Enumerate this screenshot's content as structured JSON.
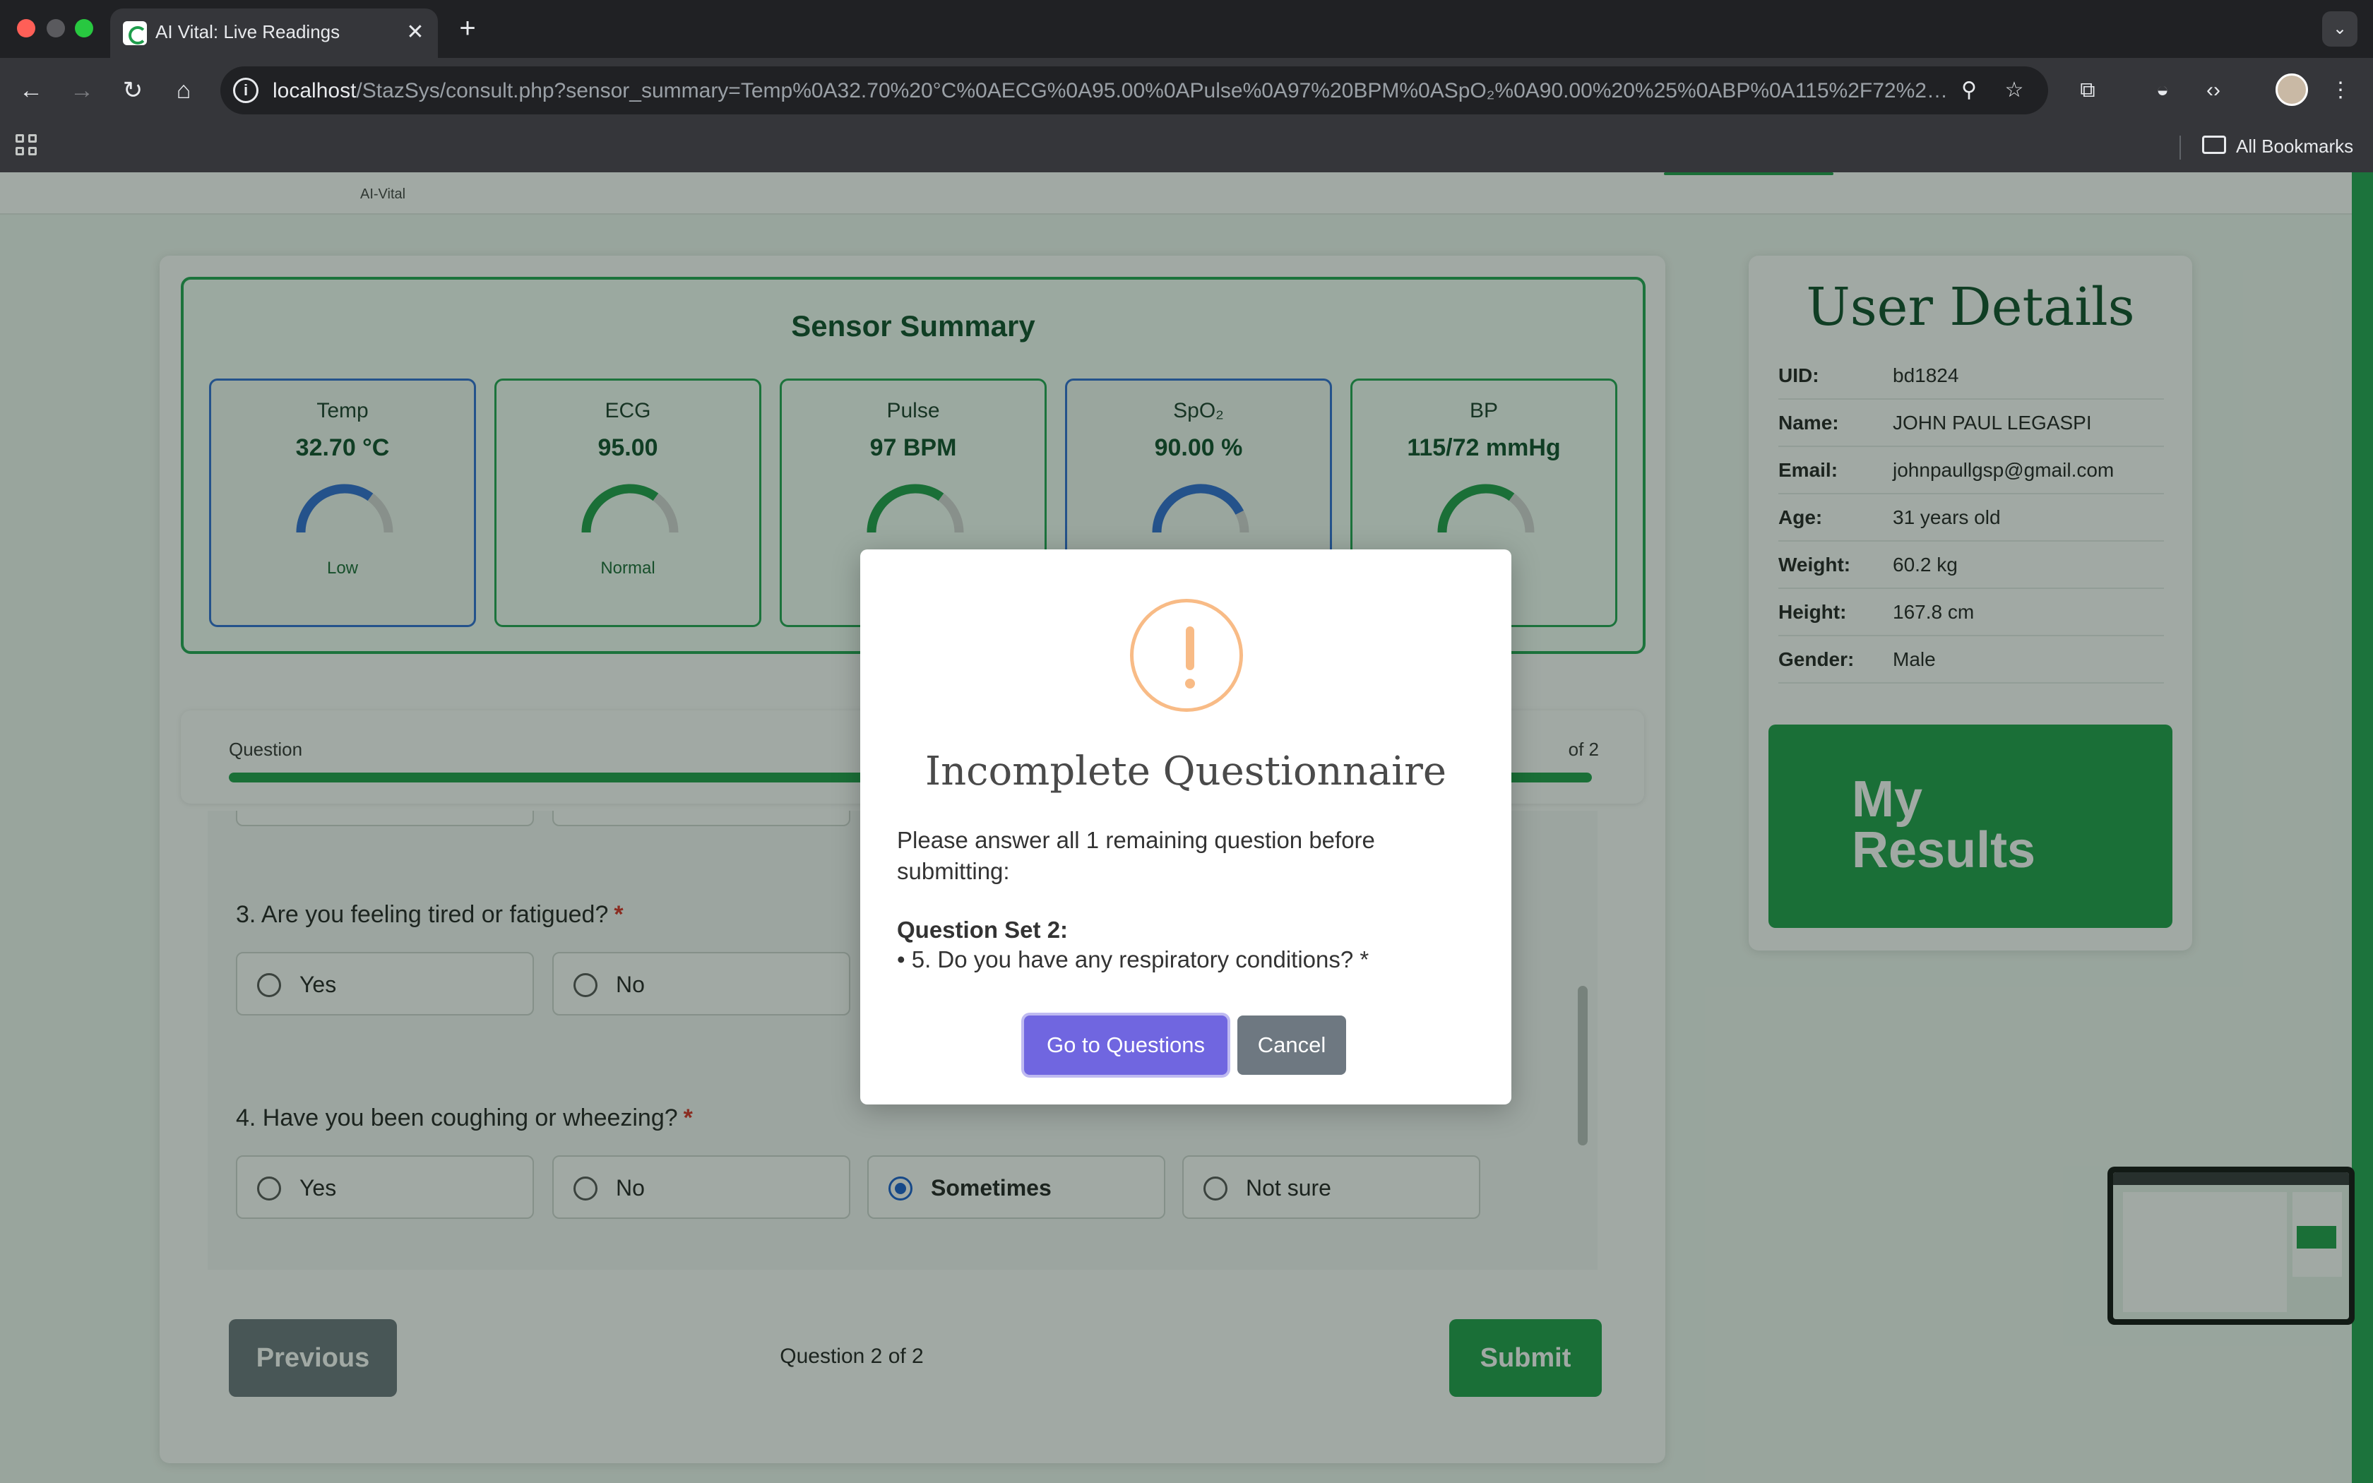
{
  "browser": {
    "tab_title": "AI Vital: Live Readings",
    "url_host": "localhost",
    "url_rest": "/StazSys/consult.php?sensor_summary=Temp%0A32.70%20°C%0AECG%0A95.00%0APulse%0A97%20BPM%0ASpO₂%0A90.00%20%25%0ABP%0A115%2F72%20...",
    "bookmarks_label": "All Bookmarks"
  },
  "header": {
    "logo_text": "AI-Vital"
  },
  "sensor_summary": {
    "title": "Sensor Summary",
    "cards": [
      {
        "name": "Temp",
        "value": "32.70 °C",
        "status": "Low",
        "level": 0.7,
        "color": "#2f6fd6",
        "state": "low"
      },
      {
        "name": "ECG",
        "value": "95.00",
        "status": "Normal",
        "level": 0.7,
        "color": "#1e9e4a",
        "state": "normal"
      },
      {
        "name": "Pulse",
        "value": "97 BPM",
        "status": "",
        "level": 0.7,
        "color": "#1e9e4a",
        "state": "normal"
      },
      {
        "name": "SpO₂",
        "value": "90.00 %",
        "status": "",
        "level": 0.85,
        "color": "#2f6fd6",
        "state": "low"
      },
      {
        "name": "BP",
        "value": "115/72 mmHg",
        "status": "",
        "level": 0.7,
        "color": "#1e9e4a",
        "state": "normal"
      }
    ]
  },
  "progress": {
    "label": "Question",
    "of_label": "of 2",
    "fill_fraction": 1.0
  },
  "questions": [
    {
      "title": "3. Are you feeling tired or fatigued?",
      "required": "*",
      "options": [
        "Yes",
        "No"
      ],
      "selected": null
    },
    {
      "title": "4. Have you been coughing or wheezing?",
      "required": "*",
      "options": [
        "Yes",
        "No",
        "Sometimes",
        "Not sure"
      ],
      "selected": 2
    }
  ],
  "footer": {
    "previous_label": "Previous",
    "indicator": "Question 2 of 2",
    "submit_label": "Submit"
  },
  "user_details": {
    "title": "User Details",
    "rows": [
      {
        "label": "UID:",
        "value": "bd1824"
      },
      {
        "label": "Name:",
        "value": "JOHN PAUL LEGASPI"
      },
      {
        "label": "Email:",
        "value": "johnpaullgsp@gmail.com"
      },
      {
        "label": "Age:",
        "value": "31 years old"
      },
      {
        "label": "Weight:",
        "value": "60.2 kg"
      },
      {
        "label": "Height:",
        "value": "167.8 cm"
      },
      {
        "label": "Gender:",
        "value": "Male"
      }
    ],
    "results_line1": "My",
    "results_line2": "Results"
  },
  "modal": {
    "title": "Incomplete Questionnaire",
    "body": "Please answer all 1 remaining question before submitting:",
    "set_label": "Question Set 2:",
    "missing_question": "• 5. Do you have any respiratory conditions? *",
    "confirm_label": "Go to Questions",
    "cancel_label": "Cancel"
  }
}
